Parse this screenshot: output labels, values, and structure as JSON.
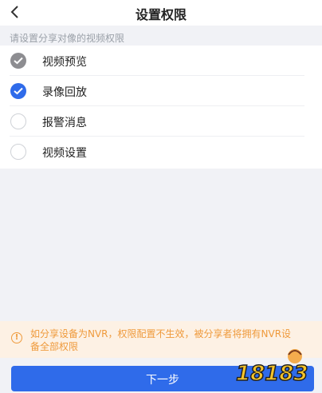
{
  "header": {
    "title": "设置权限",
    "back_icon": "chevron-left-icon"
  },
  "subtitle": "请设置分享对像的视频权限",
  "permissions": [
    {
      "label": "视频预览",
      "state": "checked-disabled"
    },
    {
      "label": "录像回放",
      "state": "checked"
    },
    {
      "label": "报警消息",
      "state": "unchecked"
    },
    {
      "label": "视频设置",
      "state": "unchecked"
    }
  ],
  "notice": {
    "icon": "warning-circle-icon",
    "text": "如分享设备为NVR，权限配置不生效，被分享者将拥有NVR设备全部权限"
  },
  "footer": {
    "next_label": "下一步"
  },
  "watermark": {
    "text": "18183"
  },
  "colors": {
    "accent": "#2f6bea",
    "warning": "#ef9a3c",
    "background": "#f1f2f6"
  }
}
